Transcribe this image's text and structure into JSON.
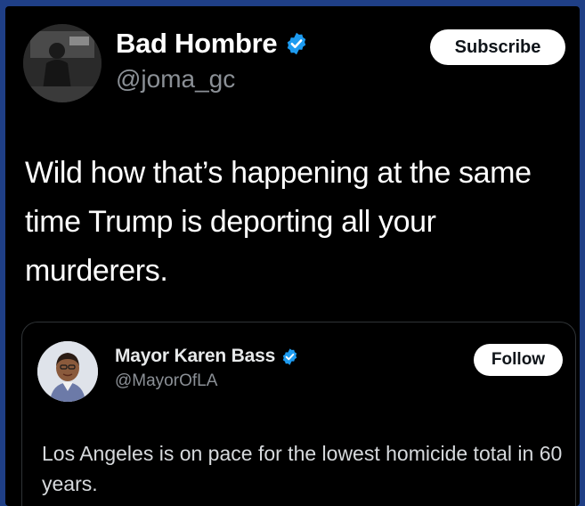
{
  "tweet": {
    "author": {
      "display_name": "Bad Hombre",
      "handle": "@joma_gc",
      "verified_icon": "verified-badge-icon",
      "avatar_icon": "avatar"
    },
    "subscribe_label": "Subscribe",
    "text": "Wild how that’s happening at the same time Trump is deporting all your murderers."
  },
  "quoted_tweet": {
    "author": {
      "display_name": "Mayor Karen Bass",
      "handle": "@MayorOfLA",
      "verified_icon": "verified-badge-icon",
      "avatar_icon": "avatar"
    },
    "follow_label": "Follow",
    "text": "Los Angeles is on pace for the lowest homicide total in 60 years."
  },
  "colors": {
    "background": "#000000",
    "outer_border": "#1f3f86",
    "verified_blue": "#1d9bf0",
    "handle_gray": "#8b9096",
    "button_bg": "#ffffff"
  }
}
